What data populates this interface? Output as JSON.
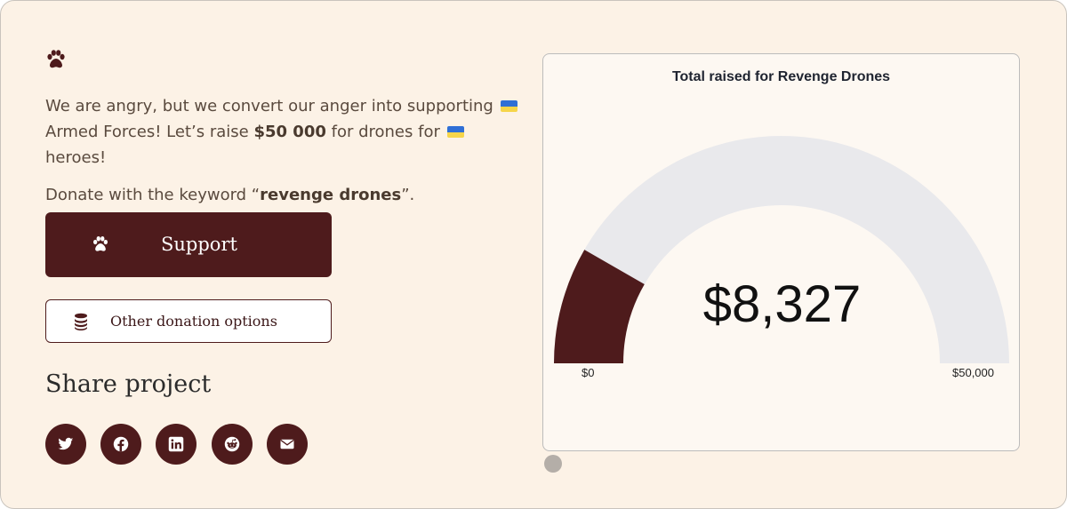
{
  "intro": {
    "line1_a": "We are angry, but we convert our anger into supporting",
    "line1_b": "Armed Forces! Let’s raise",
    "goal_bold": "$50 000",
    "line1_c": "for drones for",
    "line1_d": "heroes!",
    "donate_prefix": "Donate with the keyword “",
    "keyword": "revenge drones",
    "donate_suffix": "”."
  },
  "icons": {
    "brand": "paw-icon",
    "support": "paw-icon",
    "other": "coins-icon",
    "flag": "ukraine-flag-icon"
  },
  "buttons": {
    "support_label": "Support",
    "other_label": "Other donation options"
  },
  "share": {
    "title": "Share project",
    "networks": [
      "twitter",
      "facebook",
      "linkedin",
      "reddit",
      "email"
    ]
  },
  "gauge": {
    "title": "Total raised for Revenge Drones",
    "amount_text": "$8,327",
    "raised": 8327,
    "goal": 50000,
    "min_label": "$0",
    "max_label": "$50,000"
  },
  "colors": {
    "brand": "#4e1b1c",
    "background": "#fcf2e6",
    "gauge_track": "#e9e9ec",
    "card_bg": "#fdf8f2"
  }
}
